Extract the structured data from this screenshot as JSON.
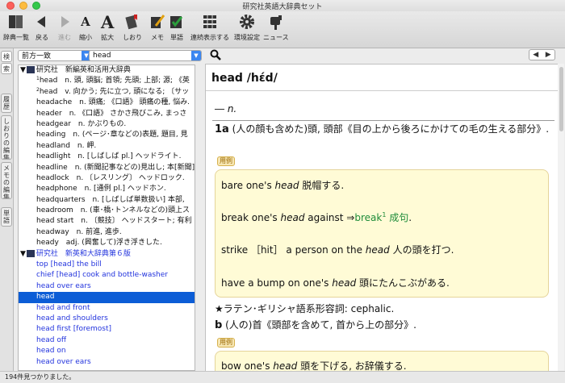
{
  "window": {
    "title": "研究社英語大辞典セット"
  },
  "toolbar": {
    "items": [
      {
        "label": "辞典一覧",
        "icon": "book-list-icon"
      },
      {
        "label": "戻る",
        "icon": "back-arrow-icon"
      },
      {
        "label": "進む",
        "icon": "forward-arrow-icon"
      },
      {
        "label": "縮小",
        "icon": "shrink-text-icon"
      },
      {
        "label": "拡大",
        "icon": "enlarge-text-icon"
      },
      {
        "label": "しおり",
        "icon": "bookmark-icon"
      },
      {
        "label": "メモ",
        "icon": "memo-icon"
      },
      {
        "label": "単語",
        "icon": "word-icon"
      },
      {
        "label": "連続表示する",
        "icon": "continuous-display-icon"
      },
      {
        "label": "環境設定",
        "icon": "gear-icon"
      },
      {
        "label": "ニュース",
        "icon": "news-icon"
      }
    ]
  },
  "sidetabs": [
    "検",
    "索",
    "履歴",
    "しおりの編集",
    "メモの編集",
    "単語"
  ],
  "search": {
    "mode": "前方一致",
    "query": "head"
  },
  "list": {
    "dict1": {
      "name": "研究社　新編英和活用大辞典"
    },
    "dict1_items": [
      {
        "sup": "1",
        "text": "head　n. 頭, 頭脳; 首領; 先頭; 上部; 源; 《英"
      },
      {
        "sup": "2",
        "text": "head　v. 向かう; 先に立つ, 頭になる; 〔サッ"
      },
      {
        "sup": "",
        "text": "headache　n. 頭痛; 《口語》 頭痛の種, 悩み."
      },
      {
        "sup": "",
        "text": "header　n. 《口語》 さかさ飛びこみ, まっさ"
      },
      {
        "sup": "",
        "text": "headgear　n. かぶりもの."
      },
      {
        "sup": "",
        "text": "heading　n. (ページ･章などの)表題, 題目, 見"
      },
      {
        "sup": "",
        "text": "headland　n. 岬."
      },
      {
        "sup": "",
        "text": "headlight　n. [しばしば pl.] ヘッドライト."
      },
      {
        "sup": "",
        "text": "headline　n. (新聞記事などの)見出し; 本[新聞]"
      },
      {
        "sup": "",
        "text": "headlock　n. 〔レスリング〕 ヘッドロック."
      },
      {
        "sup": "",
        "text": "headphone　n. [通例 pl.] ヘッドホン."
      },
      {
        "sup": "",
        "text": "headquarters　n. [しばしば単数扱い] 本部,"
      },
      {
        "sup": "",
        "text": "headroom　n. (車･橋･トンネルなどの)頭上ス"
      },
      {
        "sup": "",
        "text": "head start　n. 〔競技〕 ヘッドスタート; 有利"
      },
      {
        "sup": "",
        "text": "headway　n. 前進, 進歩."
      },
      {
        "sup": "",
        "text": "heady　adj. (興奮して)浮き浮きした."
      }
    ],
    "dict2": {
      "name": "研究社　新英和大辞典第６版"
    },
    "dict2_items": [
      "top [head] the bill",
      "chief [head] cook and bottle-washer",
      "head over ears",
      "head",
      "head and front",
      "head and shoulders",
      "head first [foremost]",
      "head off",
      "head on",
      "head over ears"
    ],
    "selected_index": 3
  },
  "entry": {
    "headword": "head /hέd/",
    "pos": "― n.",
    "sense1": {
      "num": "1a",
      "text": " (人の顔も含めた)頭, 頭部《目の上から後ろにかけての毛の生える部分》."
    },
    "yorei_label": "用例",
    "examples1": [
      {
        "pre": "bare one's ",
        "em": "head",
        "post": " 脱帽する."
      },
      {
        "pre": "break one's ",
        "em": "head",
        "post": " against ⇒",
        "link": "break",
        "sup": "1",
        "link2": "成句",
        "tail": "."
      },
      {
        "pre": "strike ［hit］ a person on the ",
        "em": "head",
        "post": " 人の頭を打つ."
      },
      {
        "pre": "have a bump on one's ",
        "em": "head",
        "post": " 頭にたんこぶがある."
      }
    ],
    "etym": "★ラテン･ギリシャ語系形容詞: cephalic.",
    "sense2": {
      "num": "b",
      "text": " (人の)首《頭部を含めて, 首から上の部分》."
    },
    "examples2": [
      {
        "pre": "bow one's ",
        "em": "head",
        "post": " 頭を下げる, お辞儀する."
      }
    ]
  },
  "status": {
    "text": "194件見つかりました。"
  }
}
